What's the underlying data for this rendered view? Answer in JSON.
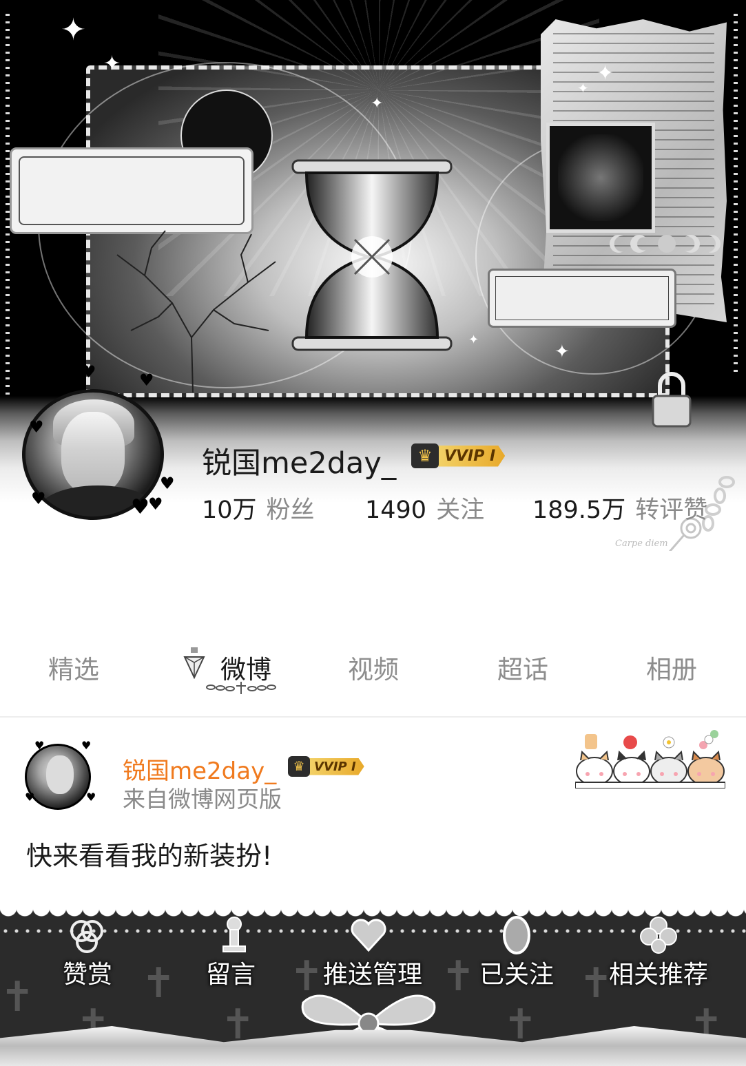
{
  "profile": {
    "username": "锐国me2day_",
    "vip_label": "VVIP I",
    "stats": [
      {
        "value": "10万",
        "label": "粉丝"
      },
      {
        "value": "1490",
        "label": "关注"
      },
      {
        "value": "189.5万",
        "label": "转评赞"
      }
    ]
  },
  "tabs": [
    {
      "label": "精选"
    },
    {
      "label": "微博"
    },
    {
      "label": "视频"
    },
    {
      "label": "超话"
    },
    {
      "label": "相册"
    }
  ],
  "post": {
    "author": "锐国me2day_",
    "vip_label": "VVIP I",
    "source": "来自微博网页版",
    "content": "快来看看我的新装扮!"
  },
  "actions": [
    {
      "label": "赞赏"
    },
    {
      "label": "留言"
    },
    {
      "label": "推送管理"
    },
    {
      "label": "已关注"
    },
    {
      "label": "相关推荐"
    }
  ],
  "colors": {
    "accent_name": "#f07a1e",
    "vip_gold": "#f1c34a"
  },
  "icons": [
    "crown-icon",
    "diamond-icon",
    "heart-icon",
    "cross-icon",
    "bow-icon"
  ]
}
